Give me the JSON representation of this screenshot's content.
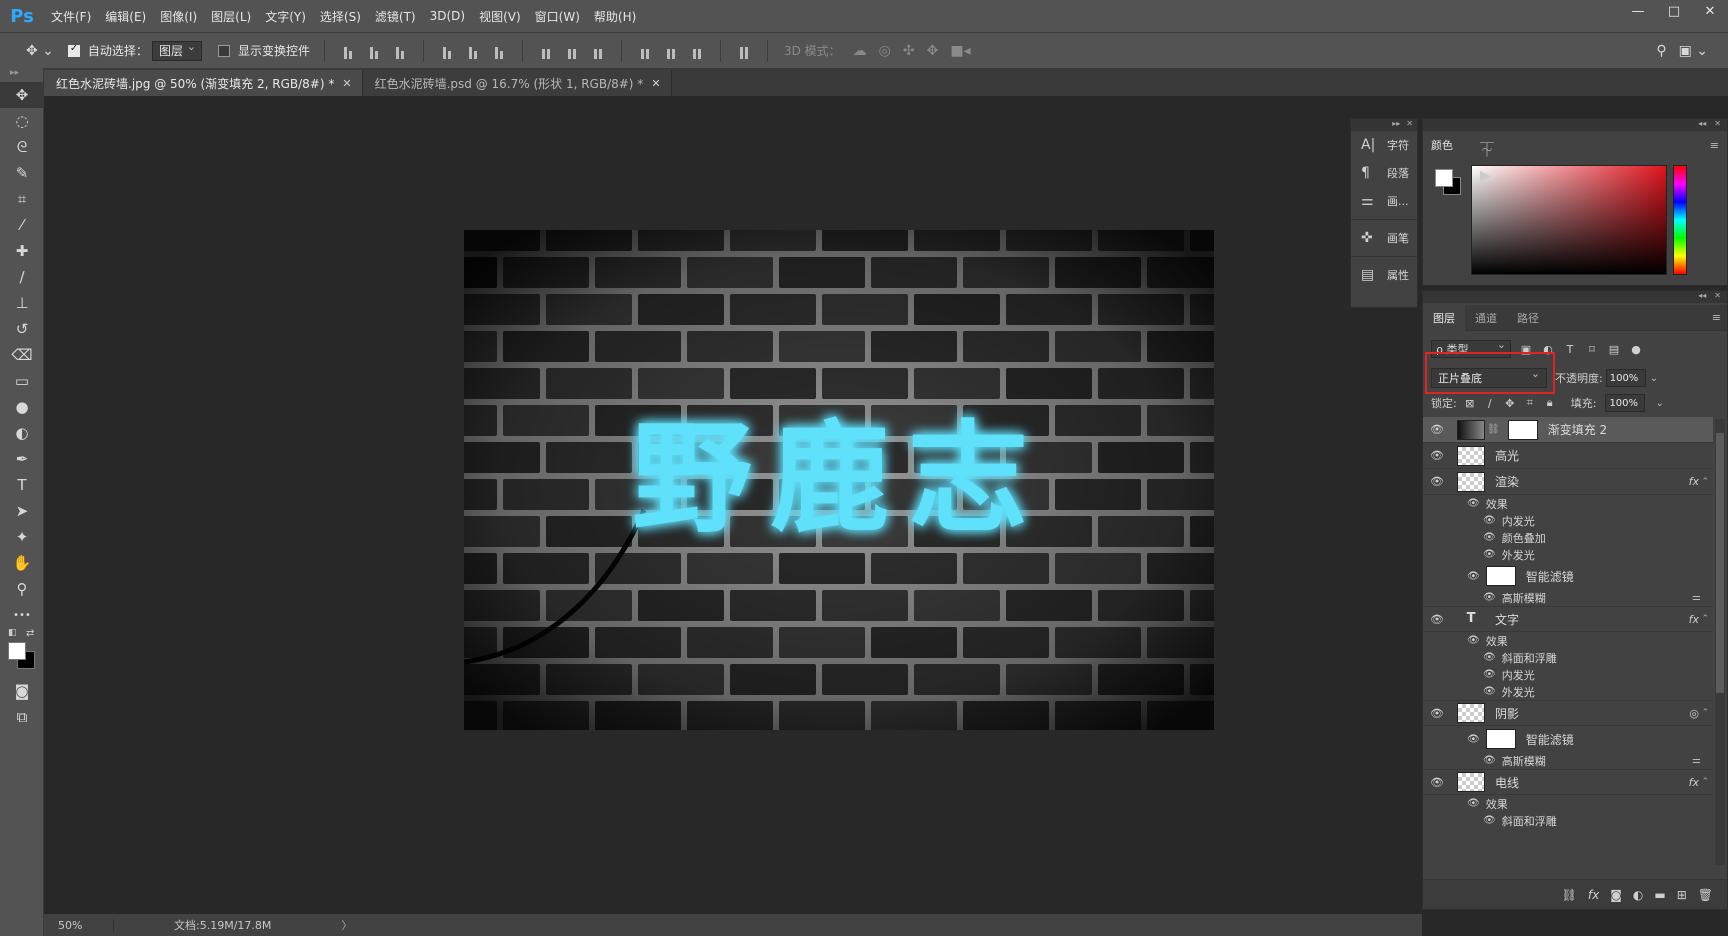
{
  "app": {
    "logo": "Ps",
    "menus": [
      "文件(F)",
      "编辑(E)",
      "图像(I)",
      "图层(L)",
      "文字(Y)",
      "选择(S)",
      "滤镜(T)",
      "3D(D)",
      "视图(V)",
      "窗口(W)",
      "帮助(H)"
    ],
    "window_controls": [
      "—",
      "□",
      "✕"
    ]
  },
  "options_bar": {
    "auto_select_label": "自动选择：",
    "auto_select_checked": true,
    "auto_select_target": "图层",
    "transform_controls_label": "显示变换控件",
    "transform_controls_checked": false,
    "mode_3d_label": "3D 模式："
  },
  "tabs": [
    {
      "label": "红色水泥砖墙.jpg @ 50% (渐变填充 2, RGB/8#) *",
      "active": true,
      "close": "✕"
    },
    {
      "label": "红色水泥砖墙.psd @ 16.7% (形状 1, RGB/8#) *",
      "active": false,
      "close": "✕"
    }
  ],
  "tools": [
    {
      "name": "move-tool-icon",
      "glyph": "✥"
    },
    {
      "name": "marquee-tool-icon",
      "glyph": "◌"
    },
    {
      "name": "lasso-tool-icon",
      "glyph": "ᘓ"
    },
    {
      "name": "quick-select-tool-icon",
      "glyph": "✎"
    },
    {
      "name": "crop-tool-icon",
      "glyph": "⌗"
    },
    {
      "name": "eyedropper-tool-icon",
      "glyph": "⁄"
    },
    {
      "name": "healing-brush-tool-icon",
      "glyph": "✚"
    },
    {
      "name": "brush-tool-icon",
      "glyph": "∕"
    },
    {
      "name": "clone-stamp-tool-icon",
      "glyph": "⊥"
    },
    {
      "name": "history-brush-tool-icon",
      "glyph": "↺"
    },
    {
      "name": "eraser-tool-icon",
      "glyph": "⌫"
    },
    {
      "name": "gradient-tool-icon",
      "glyph": "▭"
    },
    {
      "name": "blur-tool-icon",
      "glyph": "●"
    },
    {
      "name": "dodge-tool-icon",
      "glyph": "◐"
    },
    {
      "name": "pen-tool-icon",
      "glyph": "✒"
    },
    {
      "name": "type-tool-icon",
      "glyph": "T"
    },
    {
      "name": "path-select-tool-icon",
      "glyph": "➤"
    },
    {
      "name": "shape-tool-icon",
      "glyph": "✦"
    },
    {
      "name": "hand-tool-icon",
      "glyph": "✋"
    },
    {
      "name": "zoom-tool-icon",
      "glyph": "⚲"
    },
    {
      "name": "more-tools-icon",
      "glyph": "•••"
    }
  ],
  "canvas": {
    "text": "野鹿志",
    "glow_color": "#4fd6f5"
  },
  "status": {
    "zoom": "50%",
    "doc_info": "文档:5.19M/17.8M",
    "arrow": "〉"
  },
  "mini_dock": {
    "items": [
      {
        "icon": "A|",
        "label": "字符"
      },
      {
        "icon": "¶",
        "label": "段落"
      },
      {
        "icon": "⚌",
        "label": "画..."
      },
      {
        "icon": "✜",
        "label": "画笔"
      },
      {
        "icon": "▤",
        "label": "属性"
      }
    ]
  },
  "color_panel": {
    "tab": "颜色",
    "accent": "#e0141e"
  },
  "layers_panel": {
    "tabs": [
      "图层",
      "通道",
      "路径"
    ],
    "filter_label": "ρ 类型",
    "blend_mode": "正片叠底",
    "opacity_label": "不透明度:",
    "opacity_value": "100%",
    "lock_label": "锁定:",
    "fill_label": "填充:",
    "fill_value": "100%",
    "layers": {
      "gradient_fill": "渐变填充 2",
      "highlight": "高光",
      "render": "渲染",
      "render_effects": "效果",
      "render_inner_glow": "内发光",
      "render_color_overlay": "颜色叠加",
      "render_outer_glow": "外发光",
      "render_smart_filter": "智能滤镜",
      "render_gaussian": "高斯模糊",
      "text": "文字",
      "text_effects": "效果",
      "text_bevel": "斜面和浮雕",
      "text_inner_glow": "内发光",
      "text_outer_glow": "外发光",
      "shadow": "阴影",
      "shadow_smart_filter": "智能滤镜",
      "shadow_gaussian": "高斯模糊",
      "wire": "电线",
      "wire_effects": "效果",
      "wire_bevel": "斜面和浮雕"
    },
    "fx": "fx",
    "footer_icons": [
      "link-icon",
      "fx-icon",
      "mask-icon",
      "adjustment-icon",
      "folder-icon",
      "new-layer-icon",
      "trash-icon"
    ]
  },
  "colors": {
    "highlight_box": "#e02424",
    "ps_blue": "#31a8ff"
  }
}
